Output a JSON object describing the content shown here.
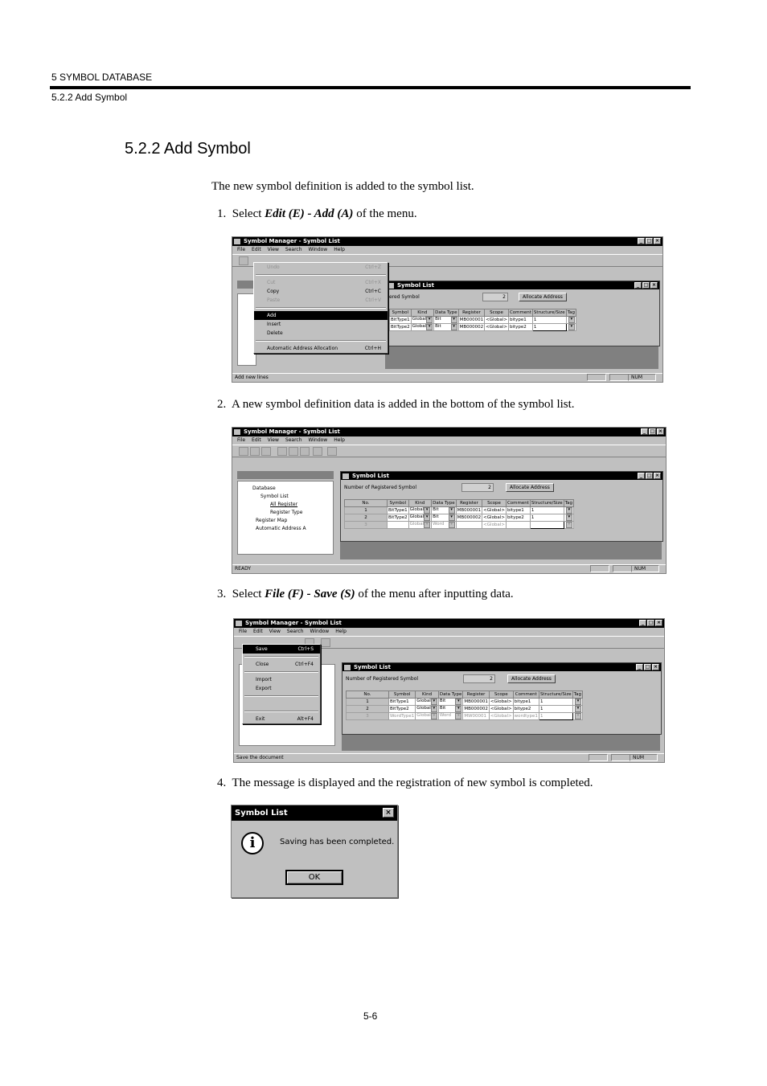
{
  "header": {
    "chapter": "5  SYMBOL DATABASE",
    "section": "5.2.2  Add Symbol"
  },
  "section_title": "5.2.2  Add Symbol",
  "intro": "The new symbol definition is added to the symbol list.",
  "steps": [
    {
      "num": "1.",
      "pre": "Select ",
      "emph": "Edit (E) - Add (A)",
      "post": " of the menu."
    },
    {
      "num": "2.",
      "text": "A new symbol definition data is added in the bottom of the symbol list."
    },
    {
      "num": "3.",
      "pre": "Select ",
      "emph": "File (F) - Save (S)",
      "post": " of the menu after inputting data."
    },
    {
      "num": "4.",
      "text": "The message is displayed and the registration of new symbol is completed."
    }
  ],
  "app": {
    "title": "Symbol Manager - Symbol List",
    "menus": [
      "File",
      "Edit",
      "View",
      "Search",
      "Window",
      "Help"
    ],
    "child_title": "Symbol List",
    "reg_label": "Number of Registered Symbol",
    "reg_label_short": "ered Symbol",
    "reg_count": "2",
    "alloc_button": "Allocate Address",
    "num_indicator": "NUM",
    "columns": [
      "No.",
      "Symbol",
      "Kind",
      "Data Type",
      "Register",
      "Scope",
      "Comment",
      "Structure/Size",
      "Tag"
    ],
    "rows1": [
      [
        "",
        "BitType1",
        "Global",
        "Bit",
        "MB000001",
        "<Global>",
        "bitype1",
        "1",
        ""
      ],
      [
        "",
        "BitType2",
        "Global",
        "Bit",
        "MB000002",
        "<Global>",
        "bitype2",
        "1",
        ""
      ]
    ],
    "rows2": [
      [
        "1",
        "BitType1",
        "Global",
        "Bit",
        "MB000001",
        "<Global>",
        "bitype1",
        "1",
        ""
      ],
      [
        "2",
        "BitType2",
        "Global",
        "Bit",
        "MB000002",
        "<Global>",
        "bitype2",
        "1",
        ""
      ],
      [
        "3",
        "",
        "Global",
        "Word",
        "",
        "<Global>",
        "",
        "",
        ""
      ]
    ],
    "rows3": [
      [
        "1",
        "BitType1",
        "Global",
        "Bit",
        "MB000001",
        "<Global>",
        "bitype1",
        "1",
        ""
      ],
      [
        "2",
        "BitType2",
        "Global",
        "Bit",
        "MB000002",
        "<Global>",
        "bitype2",
        "1",
        ""
      ],
      [
        "3",
        "WordType1",
        "Global",
        "Word",
        "MW00001",
        "<Global>",
        "wordtype1",
        "1",
        ""
      ]
    ]
  },
  "edit_menu": {
    "items": [
      {
        "label": "Undo",
        "shortcut": "Ctrl+Z",
        "state": "gray"
      },
      {
        "label": "Cut",
        "shortcut": "Ctrl+X",
        "state": "gray"
      },
      {
        "label": "Copy",
        "shortcut": "Ctrl+C",
        "state": "normal"
      },
      {
        "label": "Paste",
        "shortcut": "Ctrl+V",
        "state": "gray"
      },
      {
        "label": "Add",
        "shortcut": "",
        "state": "selected"
      },
      {
        "label": "Insert",
        "shortcut": "",
        "state": "normal"
      },
      {
        "label": "Delete",
        "shortcut": "",
        "state": "normal"
      },
      {
        "label": "Automatic Address Allocation",
        "shortcut": "Ctrl+H",
        "state": "normal"
      }
    ],
    "status": "Add new lines"
  },
  "tree": {
    "items": [
      "Database",
      "Symbol List",
      "All Register",
      "Register Type",
      "Register Map",
      "Automatic Address A"
    ],
    "status": "READY"
  },
  "file_menu": {
    "items": [
      {
        "label": "Save",
        "shortcut": "Ctrl+S",
        "state": "selected"
      },
      {
        "label": "Close",
        "shortcut": "Ctrl+F4",
        "state": "normal"
      },
      {
        "label": "Import",
        "shortcut": "",
        "state": "normal"
      },
      {
        "label": "Export",
        "shortcut": "",
        "state": "normal"
      },
      {
        "label": "Exit",
        "shortcut": "Alt+F4",
        "state": "normal"
      }
    ],
    "status": "Save the document"
  },
  "dialog": {
    "title": "Symbol List",
    "message": "Saving has been completed.",
    "ok": "OK",
    "close": "×"
  },
  "footer": {
    "page": "5-6"
  }
}
